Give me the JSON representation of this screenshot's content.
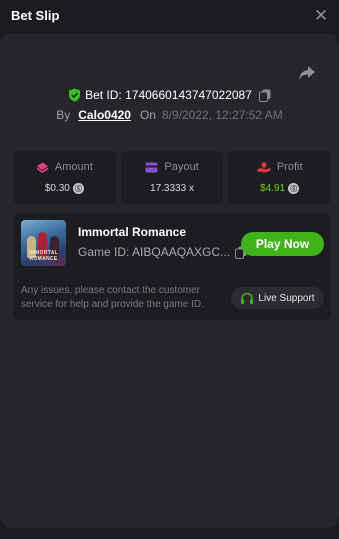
{
  "header": {
    "title": "Bet Slip"
  },
  "bet": {
    "id_text": "Bet ID: 1740660143747022087",
    "by_label": "By",
    "username": "Calo0420",
    "on_label": "On",
    "date": "8/9/2022, 12:27:52 AM"
  },
  "stats": [
    {
      "label": "Amount",
      "value": "$0.30",
      "icon": "ticket-icon",
      "color": "#e0457b"
    },
    {
      "label": "Payout",
      "value": "17.3333 x",
      "icon": "wallet-icon",
      "color": "#8a4dd8"
    },
    {
      "label": "Profit",
      "value": "$4.91",
      "icon": "hand-coin-icon",
      "color": "#e53a3a"
    }
  ],
  "game": {
    "name": "Immortal Romance",
    "id_text": "Game ID: AIBQAAQAXGC...",
    "thumb_caption": "IMMORTAL ROMANCE",
    "play_label": "Play Now",
    "support_note": "Any issues, please contact the customer service for help and provide the game ID.",
    "live_support_label": "Live Support"
  },
  "colors": {
    "accent_green": "#3fb319",
    "profit_green": "#6fd11e",
    "background": "#1b1c1f",
    "panel": "#24262b"
  }
}
